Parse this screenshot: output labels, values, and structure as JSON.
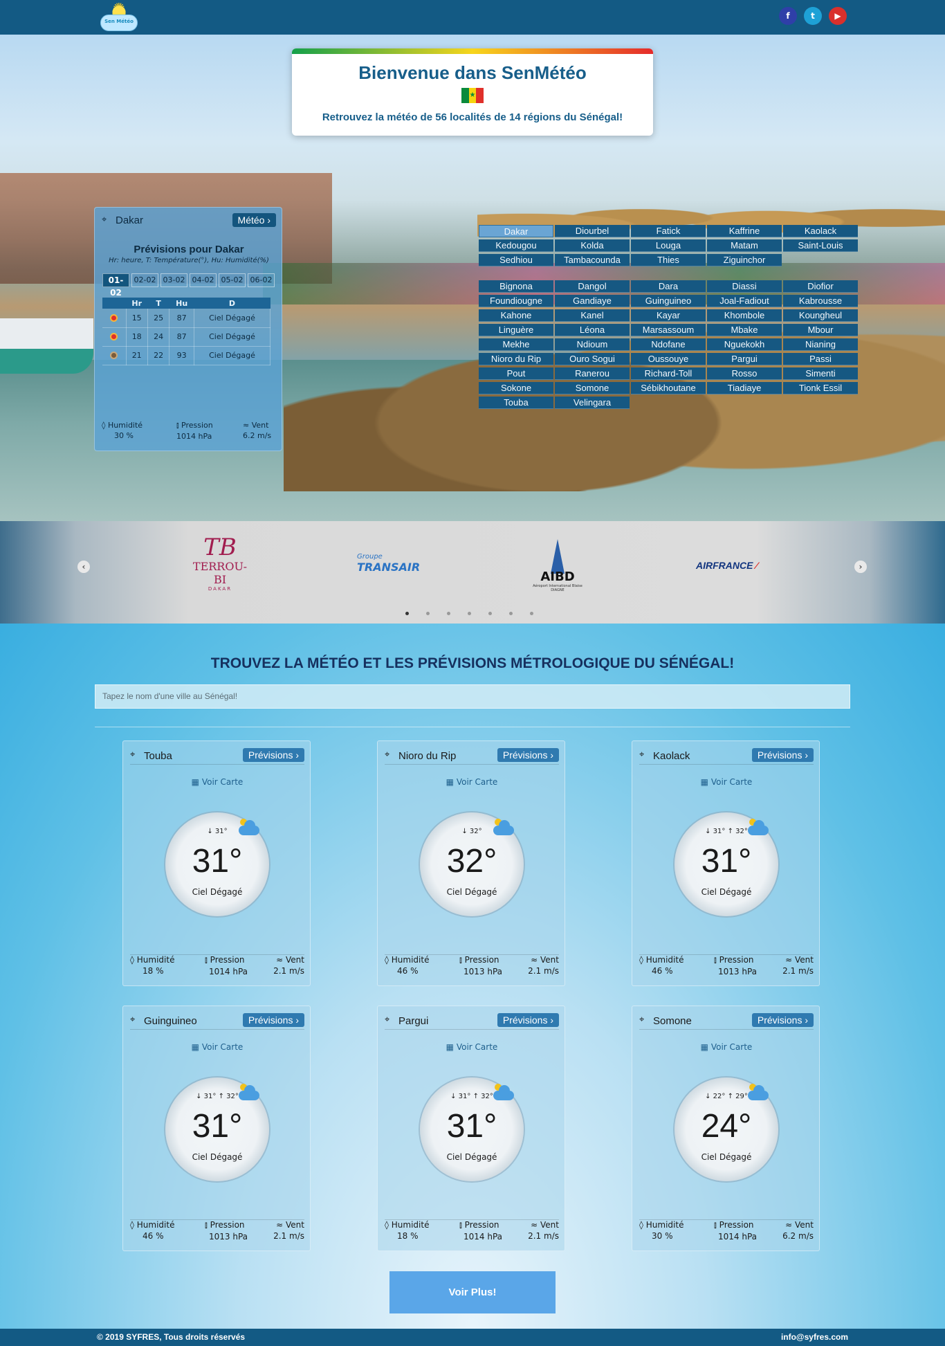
{
  "header": {
    "logo_text": "Sen Météo",
    "social": [
      "f",
      "t",
      "▶"
    ]
  },
  "welcome": {
    "title": "Bienvenue dans SenMétéo",
    "subtitle": "Retrouvez la météo de 56 localités de 14 régions du Sénégal!"
  },
  "dakar_panel": {
    "city": "Dakar",
    "button": "Météo ›",
    "title": "Prévisions pour Dakar",
    "legend": "Hr: heure, T: Température(°), Hu: Humidité(%)",
    "days": [
      "01-02",
      "02-02",
      "03-02",
      "04-02",
      "05-02",
      "06-02"
    ],
    "columns": [
      "Hr",
      "T",
      "Hu",
      "D"
    ],
    "rows": [
      {
        "hr": "15",
        "t": "25",
        "hu": "87",
        "d": "Ciel Dégagé"
      },
      {
        "hr": "18",
        "t": "24",
        "hu": "87",
        "d": "Ciel Dégagé"
      },
      {
        "hr": "21",
        "t": "22",
        "hu": "93",
        "d": "Ciel Dégagé"
      }
    ],
    "humidity_label": "Humidité",
    "humidity": "30 %",
    "pressure_label": "Pression",
    "pressure": "1014 hPa",
    "wind_label": "Vent",
    "wind": "6.2 m/s"
  },
  "regions": [
    "Dakar",
    "Diourbel",
    "Fatick",
    "Kaffrine",
    "Kaolack",
    "Kedougou",
    "Kolda",
    "Louga",
    "Matam",
    "Saint-Louis",
    "Sedhiou",
    "Tambacounda",
    "Thies",
    "Ziguinchor"
  ],
  "localities": [
    "Bignona",
    "Dangol",
    "Dara",
    "Diassi",
    "Diofior",
    "Foundiougne",
    "Gandiaye",
    "Guinguineo",
    "Joal-Fadiout",
    "Kabrousse",
    "Kahone",
    "Kanel",
    "Kayar",
    "Khombole",
    "Koungheul",
    "Linguère",
    "Léona",
    "Marsassoum",
    "Mbake",
    "Mbour",
    "Mekhe",
    "Ndioum",
    "Ndofane",
    "Nguekokh",
    "Nianing",
    "Nioro du Rip",
    "Ouro Sogui",
    "Oussouye",
    "Pargui",
    "Passi",
    "Pout",
    "Ranerou",
    "Richard-Toll",
    "Rosso",
    "Simenti",
    "Sokone",
    "Somone",
    "Sébikhoutane",
    "Tiadiaye",
    "Tionk Essil",
    "Touba",
    "Velingara"
  ],
  "partners": {
    "terrou_mono": "TB",
    "terrou_name": "TERROU-BI",
    "terrou_sub": "DAKAR",
    "transair_group": "Groupe",
    "transair_name": "TRANSAIR",
    "aibd_name": "AIBD",
    "aibd_caption": "Aéroport International Blaise DIAGNE",
    "airfrance": "AIRFRANCE"
  },
  "main": {
    "title": "TROUVEZ LA MÉTÉO ET LES PRÉVISIONS MÉTROLOGIQUE DU SÉNÉGAL!",
    "search_placeholder": "Tapez le nom d'une ville au Sénégal!",
    "card_button": "Prévisions ›",
    "map_link": "Voir Carte",
    "humidity_label": "Humidité",
    "pressure_label": "Pression",
    "wind_label": "Vent",
    "more_button": "Voir Plus!"
  },
  "cards": [
    {
      "city": "Touba",
      "minmax": "↓ 31°",
      "temp": "31°",
      "desc": "Ciel Dégagé",
      "humidity": "18 %",
      "pressure": "1014 hPa",
      "wind": "2.1 m/s"
    },
    {
      "city": "Nioro du Rip",
      "minmax": "↓ 32°",
      "temp": "32°",
      "desc": "Ciel Dégagé",
      "humidity": "46 %",
      "pressure": "1013 hPa",
      "wind": "2.1 m/s"
    },
    {
      "city": "Kaolack",
      "minmax": "↓ 31° ↑ 32°",
      "temp": "31°",
      "desc": "Ciel Dégagé",
      "humidity": "46 %",
      "pressure": "1013 hPa",
      "wind": "2.1 m/s"
    },
    {
      "city": "Guinguineo",
      "minmax": "↓ 31° ↑ 32°",
      "temp": "31°",
      "desc": "Ciel Dégagé",
      "humidity": "46 %",
      "pressure": "1013 hPa",
      "wind": "2.1 m/s"
    },
    {
      "city": "Pargui",
      "minmax": "↓ 31° ↑ 32°",
      "temp": "31°",
      "desc": "Ciel Dégagé",
      "humidity": "18 %",
      "pressure": "1014 hPa",
      "wind": "2.1 m/s"
    },
    {
      "city": "Somone",
      "minmax": "↓ 22° ↑ 29°",
      "temp": "24°",
      "desc": "Ciel Dégagé",
      "humidity": "30 %",
      "pressure": "1014 hPa",
      "wind": "6.2 m/s"
    }
  ],
  "footer": {
    "copyright": "© 2019 SYFRES, Tous droits réservés",
    "email": "info@syfres.com"
  }
}
